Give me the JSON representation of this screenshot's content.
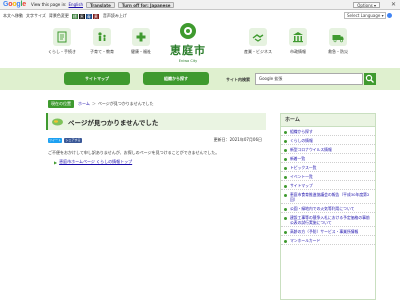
{
  "translate_bar": {
    "logo_letters": [
      "G",
      "o",
      "o",
      "g",
      "l",
      "e"
    ],
    "view_text": "View this page in:",
    "language": "English",
    "translate_label": "Translate",
    "turn_off_label": "Turn off for: Japanese",
    "options_label": "Options ▾",
    "close_glyph": "✕"
  },
  "utility": {
    "items": [
      "本文へ移動",
      "文字サイズ",
      "背景色変更"
    ],
    "color_boxes": [
      "標",
      "黒",
      "青",
      "黄"
    ],
    "extra": "音声読み上げ",
    "language_select": "Select Language ▾"
  },
  "nav": {
    "items": [
      {
        "label": "くらし・手続き",
        "icon": "document-icon"
      },
      {
        "label": "子育て・教育",
        "icon": "family-icon"
      },
      {
        "label": "健康・福祉",
        "icon": "health-icon"
      },
      {
        "label": "産業・ビジネス",
        "icon": "handshake-icon"
      },
      {
        "label": "市政情報",
        "icon": "cityhall-icon"
      },
      {
        "label": "救急・防災",
        "icon": "ambulance-icon"
      }
    ],
    "logo_name": "恵庭市",
    "logo_sub": "Eniwa City"
  },
  "band": {
    "sitemap_label": "サイトマップ",
    "org_search_label": "組織から探す",
    "site_search_label": "サイト内検索",
    "search_value": "Google 拡張",
    "colors": {
      "accent": "#3f9a2f",
      "band": "#dff0cf"
    }
  },
  "breadcrumb": {
    "current_tag": "現在の位置",
    "home": "ホーム",
    "sep": "＞",
    "here": "ページが見つかりませんでした"
  },
  "main": {
    "title": "ページが見つかりませんでした",
    "tweet_label": "ツイート",
    "share_label": "シェアする",
    "updated": "更新日：2021年07月06日",
    "message": "ご不便をおかけして申し訳ありませんが、お探しのページを見つけることができませんでした。",
    "links": [
      "恵庭市ホームページ くらしの情報トップ"
    ]
  },
  "side": {
    "heading": "ホーム",
    "items": [
      "組織から探す",
      "くらしの情報",
      "新型コロナウイルス情報",
      "新着一覧",
      "トピックス一覧",
      "イベント一覧",
      "サイトマップ",
      "恵庭市食育推進協議会の報告（平成30年度第2回）",
      "公園・緑地内での火気等利用について",
      "建設工事等の競争入札における予定価格の事前公表の試行実施について",
      "高齢の方（予防）サービス・事業所情報",
      "マンホールカード"
    ]
  }
}
